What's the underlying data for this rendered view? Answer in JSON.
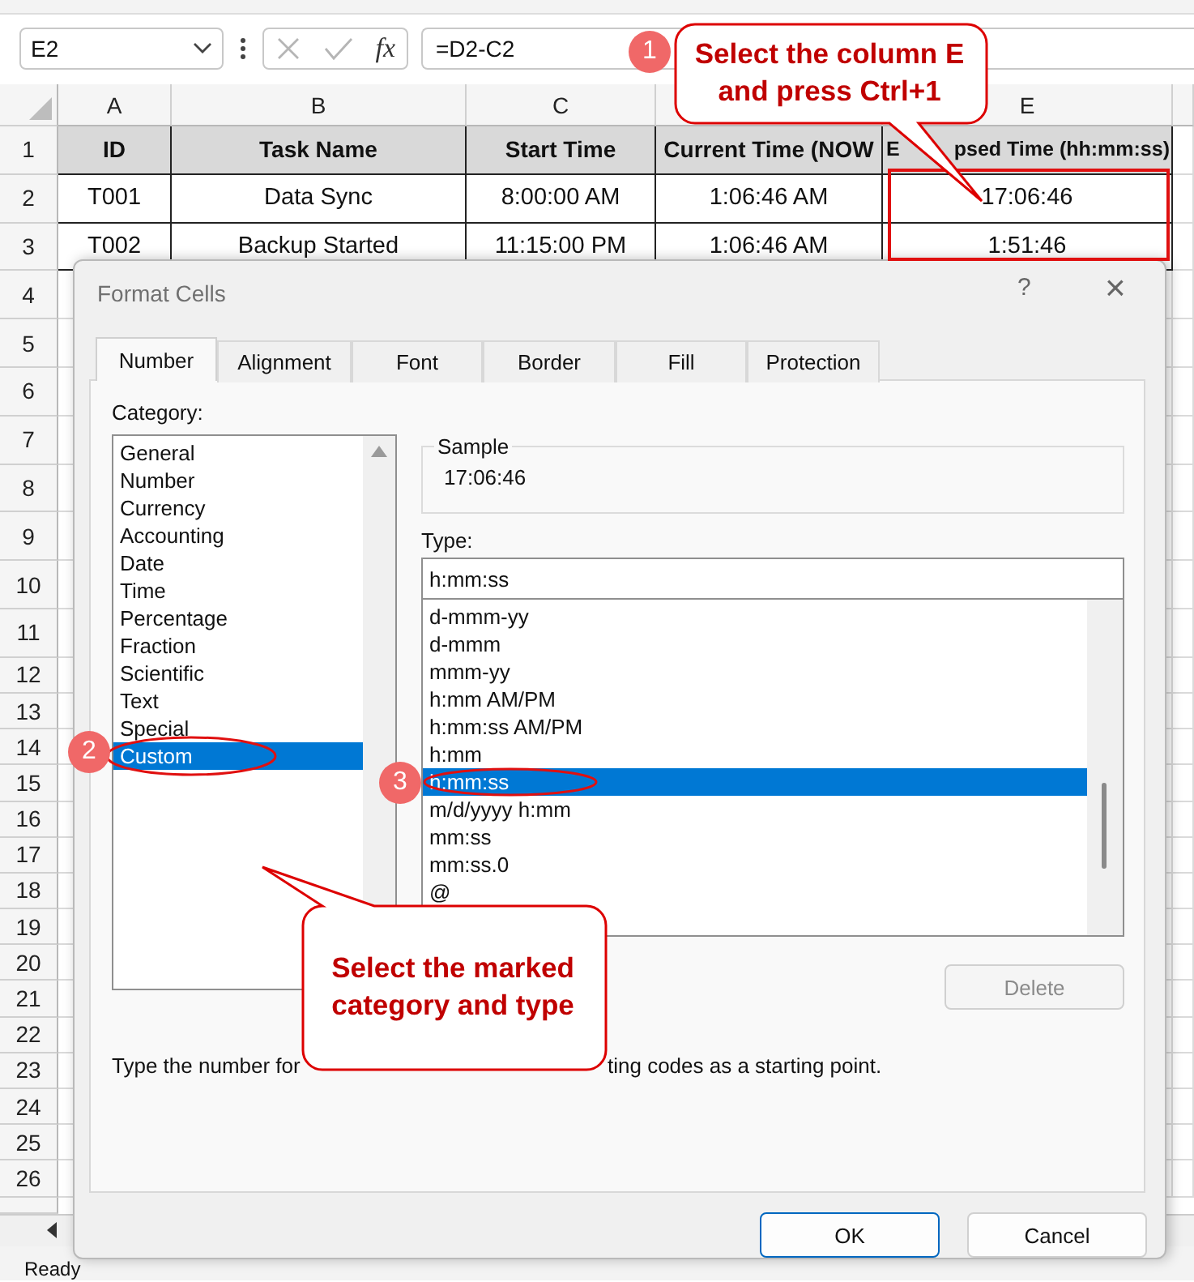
{
  "formula_bar": {
    "name_box": "E2",
    "function_label": "fx",
    "formula": "=D2-C2"
  },
  "sheet": {
    "column_letters": [
      "A",
      "B",
      "C",
      "E"
    ],
    "header": [
      "ID",
      "Task Name",
      "Start Time",
      "Current Time (NOW"
    ],
    "header_last_parts": [
      "E",
      "psed Time (hh:mm:ss)"
    ],
    "rows": [
      [
        "T001",
        "Data Sync",
        "8:00:00 AM",
        "1:06:46 AM",
        "17:06:46"
      ],
      [
        "T002",
        "Backup Started",
        "11:15:00 PM",
        "1:06:46 AM",
        "1:51:46"
      ]
    ],
    "row_numbers": [
      "1",
      "2",
      "3",
      "4",
      "5",
      "6",
      "7",
      "8",
      "9",
      "10",
      "11",
      "12",
      "13",
      "14",
      "15",
      "16",
      "17",
      "18",
      "19",
      "20",
      "21",
      "22",
      "23",
      "24",
      "25",
      "26"
    ]
  },
  "dialog": {
    "title": "Format Cells",
    "help": "?",
    "close": "×",
    "tabs": [
      {
        "label": "Number",
        "selected": true
      },
      {
        "label": "Alignment",
        "selected": false
      },
      {
        "label": "Font",
        "selected": false
      },
      {
        "label": "Border",
        "selected": false
      },
      {
        "label": "Fill",
        "selected": false
      },
      {
        "label": "Protection",
        "selected": false
      }
    ],
    "category_label": "Category:",
    "categories": [
      {
        "label": "General",
        "selected": false
      },
      {
        "label": "Number",
        "selected": false
      },
      {
        "label": "Currency",
        "selected": false
      },
      {
        "label": "Accounting",
        "selected": false
      },
      {
        "label": "Date",
        "selected": false
      },
      {
        "label": "Time",
        "selected": false
      },
      {
        "label": "Percentage",
        "selected": false
      },
      {
        "label": "Fraction",
        "selected": false
      },
      {
        "label": "Scientific",
        "selected": false
      },
      {
        "label": "Text",
        "selected": false
      },
      {
        "label": "Special",
        "selected": false
      },
      {
        "label": "Custom",
        "selected": true
      }
    ],
    "sample_label": "Sample",
    "sample_value": "17:06:46",
    "type_label": "Type:",
    "type_value": "h:mm:ss",
    "types": [
      {
        "label": "d-mmm-yy",
        "selected": false
      },
      {
        "label": "d-mmm",
        "selected": false
      },
      {
        "label": "mmm-yy",
        "selected": false
      },
      {
        "label": "h:mm AM/PM",
        "selected": false
      },
      {
        "label": "h:mm:ss AM/PM",
        "selected": false
      },
      {
        "label": "h:mm",
        "selected": false
      },
      {
        "label": "h:mm:ss",
        "selected": true
      },
      {
        "label": "m/d/yyyy h:mm",
        "selected": false
      },
      {
        "label": "mm:ss",
        "selected": false
      },
      {
        "label": "mm:ss.0",
        "selected": false
      },
      {
        "label": "@",
        "selected": false
      }
    ],
    "delete_button": {
      "label": "Delete",
      "disabled": true
    },
    "description_parts": [
      "Type the number for",
      "ting codes as a starting point."
    ],
    "buttons": [
      {
        "label": "OK",
        "default": true
      },
      {
        "label": "Cancel",
        "default": false
      }
    ]
  },
  "annotations": {
    "badges": [
      "1",
      "2",
      "3"
    ],
    "callouts": [
      "Select the column E and press Ctrl+1",
      "Select the marked category and type"
    ]
  },
  "status_bar": {
    "mode": "Ready"
  }
}
